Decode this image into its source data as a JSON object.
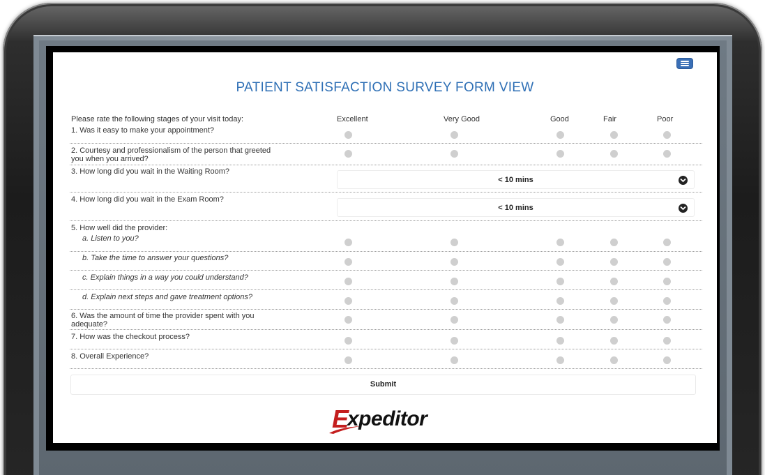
{
  "survey": {
    "title": "PATIENT SATISFACTION SURVEY FORM VIEW",
    "intro": "Please rate the following stages of your visit today:",
    "columns": [
      "Excellent",
      "Very Good",
      "Good",
      "Fair",
      "Poor"
    ],
    "questions": {
      "q1": "1. Was it easy to make your appointment?",
      "q2a": "2. Courtesy and professionalism of the person that greeted",
      "q2b": "you when you arrived?",
      "q3": "3. How long did you wait in the Waiting Room?",
      "q4": "4. How long did you wait in the Exam Room?",
      "q5": "5. How well did the provider:",
      "q5a": "a. Listen to you?",
      "q5b": "b. Take the time to answer your questions?",
      "q5c": "c. Explain things in a way you could understand?",
      "q5d": "d. Explain next steps and gave treatment options?",
      "q6a": "6. Was the amount of time the provider spent with you",
      "q6b": "adequate?",
      "q7": "7. How was the checkout process?",
      "q8": "8. Overall Experience?"
    },
    "wait_room_value": "< 10 mins",
    "exam_room_value": "< 10 mins",
    "submit_label": "Submit"
  },
  "logo": {
    "letter": "E",
    "text": "xpeditor",
    "brand_color": "#c41e1e"
  },
  "colors": {
    "title": "#2e6fb5",
    "menu_button": "#3a6fb6"
  },
  "icons": {
    "menu": "hamburger-menu-icon",
    "select": "chevron-down-circle-icon"
  }
}
